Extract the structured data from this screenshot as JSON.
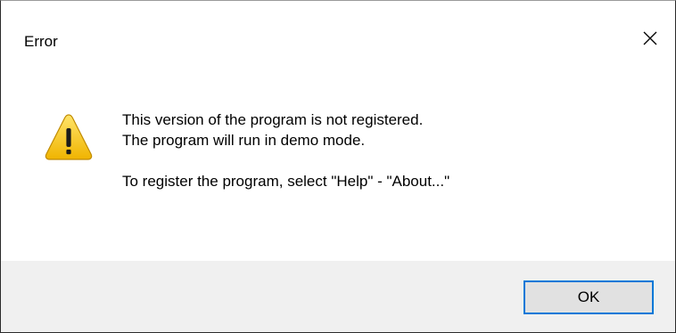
{
  "dialog": {
    "title": "Error",
    "close_icon": "close-icon",
    "warning_icon": "warning-icon",
    "message_lines": [
      "This version of the program is not registered.",
      "The program will run in demo mode."
    ],
    "message_register": "To register the program, select \"Help\" - \"About...\"",
    "ok_label": "OK"
  },
  "colors": {
    "accent": "#0078d7",
    "footer_bg": "#f0f0f0",
    "button_bg": "#e1e1e1",
    "warning_fill": "#f5c400"
  }
}
